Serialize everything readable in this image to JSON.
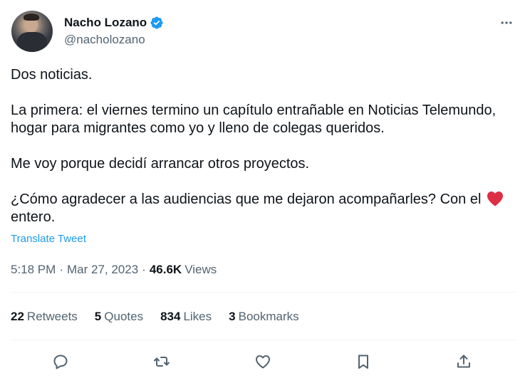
{
  "author": {
    "display_name": "Nacho Lozano",
    "handle": "@nacholozano",
    "verified": true,
    "avatar_icon": "profile-photo"
  },
  "tweet": {
    "paragraphs": [
      "Dos noticias.",
      "La primera: el viernes termino un capítulo entrañable en Noticias Telemundo, hogar para migrantes como yo y lleno de colegas queridos.",
      "Me voy porque decidí arrancar otros proyectos."
    ],
    "last_paragraph_before_heart": "¿Cómo agradecer a las audiencias que me dejaron acompañarles? Con el",
    "last_paragraph_after_heart": "entero.",
    "heart_emoji": "red-heart",
    "translate_label": "Translate Tweet"
  },
  "meta": {
    "time": "5:18 PM",
    "separator": "·",
    "date": "Mar 27, 2023",
    "views_count": "46.6K",
    "views_label": "Views"
  },
  "stats": [
    {
      "count": "22",
      "label": "Retweets"
    },
    {
      "count": "5",
      "label": "Quotes"
    },
    {
      "count": "834",
      "label": "Likes"
    },
    {
      "count": "3",
      "label": "Bookmarks"
    }
  ],
  "actions": [
    "reply-icon",
    "retweet-icon",
    "like-icon",
    "bookmark-icon",
    "share-icon"
  ],
  "colors": {
    "text": "#0f1419",
    "secondary": "#536471",
    "accent": "#1d9bf0",
    "heart": "#e0245e",
    "divider": "#eff3f4"
  }
}
